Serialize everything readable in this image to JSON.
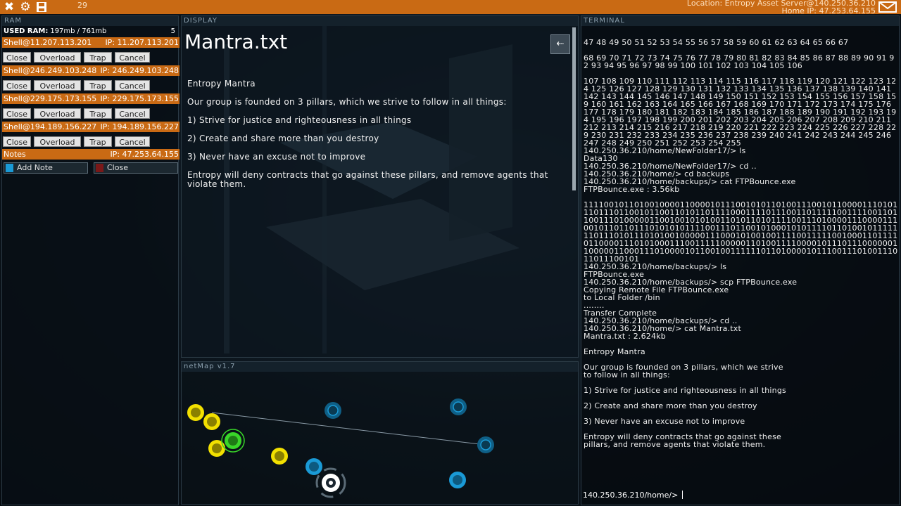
{
  "topbar": {
    "counter": "29",
    "location": "Location: Entropy Asset Server@140.250.36.210",
    "home_ip": "Home IP: 47.253.64.155",
    "exit_icon": "close-icon",
    "settings_icon": "gear-icon",
    "save_icon": "save-icon",
    "mail_icon": "mail-icon"
  },
  "ram": {
    "header": "RAM",
    "used_label": "USED RAM:",
    "used_value": "197mb / 761mb",
    "count": "5",
    "shells": [
      {
        "name": "Shell@11.207.113.201",
        "ip": "IP: 11.207.113.201"
      },
      {
        "name": "Shell@246.249.103.248",
        "ip": "IP: 246.249.103.248"
      },
      {
        "name": "Shell@229.175.173.155",
        "ip": "IP: 229.175.173.155"
      },
      {
        "name": "Shell@194.189.156.227",
        "ip": "IP: 194.189.156.227"
      }
    ],
    "buttons": {
      "close": "Close",
      "overload": "Overload",
      "trap": "Trap",
      "cancel": "Cancel"
    },
    "notes": {
      "label": "Notes",
      "ip": "IP: 47.253.64.155",
      "add": "Add Note",
      "close": "Close"
    }
  },
  "display": {
    "header": "DISPLAY",
    "title": "Mantra.txt",
    "back": "⇠",
    "paragraphs": [
      "Entropy Mantra",
      "Our group is founded on 3 pillars, which we strive to follow in all things:",
      "",
      "1) Strive for justice and righteousness in all things",
      "2) Create and share more than you destroy",
      "3) Never have an excuse not to improve",
      "Entropy will deny contracts that go against these pillars, and remove agents that violate them."
    ]
  },
  "netmap": {
    "header": "netMap v1.7"
  },
  "terminal": {
    "header": "TERMINAL",
    "output": "47 48 49 50 51 52 53 54 55 56 57 58 59 60 61 62 63 64 65 66 67\n\n68 69 70 71 72 73 74 75 76 77 78 79 80 81 82 83 84 85 86 87 88 89 90 91 92 93 94 95 96 97 98 99 100 101 102 103 104 105 106\n\n107 108 109 110 111 112 113 114 115 116 117 118 119 120 121 122 123 124 125 126 127 128 129 130 131 132 133 134 135 136 137 138 139 140 141 142 143 144 145 146 147 148 149 150 151 152 153 154 155 156 157 158 159 160 161 162 163 164 165 166 167 168 169 170 171 172 173 174 175 176 177 178 179 180 181 182 183 184 185 186 187 188 189 190 191 192 193 194 195 196 197 198 199 200 201 202 203 204 205 206 207 208 209 210 211 212 213 214 215 216 217 218 219 220 221 222 223 224 225 226 227 228 229 230 231 232 233 234 235 236 237 238 239 240 241 242 243 244 245 246 247 248 249 250 251 252 253 254 255\n140.250.36.210/home/NewFolder17/> ls\nData130\n140.250.36.210/home/NewFolder17/> cd ..\n140.250.36.210/home/> cd backups\n140.250.36.210/home/backups/> cat FTPBounce.exe\nFTPBounce.exe : 3.56kb\n\n1111001011010010000110000101110010101101001110010110000111010111011101100101100110101101111000111101110011011111001111001101100111010000011001001010100110101101011110011101000011100001110010110110111010101011110011101100101000101011110110100101111111011101011101010010000011100010100100111100111110010001101111011000011101010001110011111000001101001111000010111011100000011000001100011101000010110010011111101101000010111001110100111011011100101\n140.250.36.210/home/backups/> ls\nFTPBounce.exe\n140.250.36.210/home/backups/> scp FTPBounce.exe\nCopying Remote File FTPBounce.exe\nto Local Folder /bin\n........\nTransfer Complete\n140.250.36.210/home/backups/> cd ..\n140.250.36.210/home/> cat Mantra.txt\nMantra.txt : 2.624kb\n\nEntropy Mantra\n\nOur group is founded on 3 pillars, which we strive\nto follow in all things:\n\n1) Strive for justice and righteousness in all things\n\n2) Create and share more than you destroy\n\n3) Never have an excuse not to improve\n\nEntropy will deny contracts that go against these\npillars, and remove agents that violate them.",
    "prompt": "140.250.36.210/home/>"
  },
  "colors": {
    "accent_orange": "#c96a14",
    "node_yellow": "#f2e000",
    "node_green": "#39d629",
    "node_blue": "#1a9ad6"
  }
}
